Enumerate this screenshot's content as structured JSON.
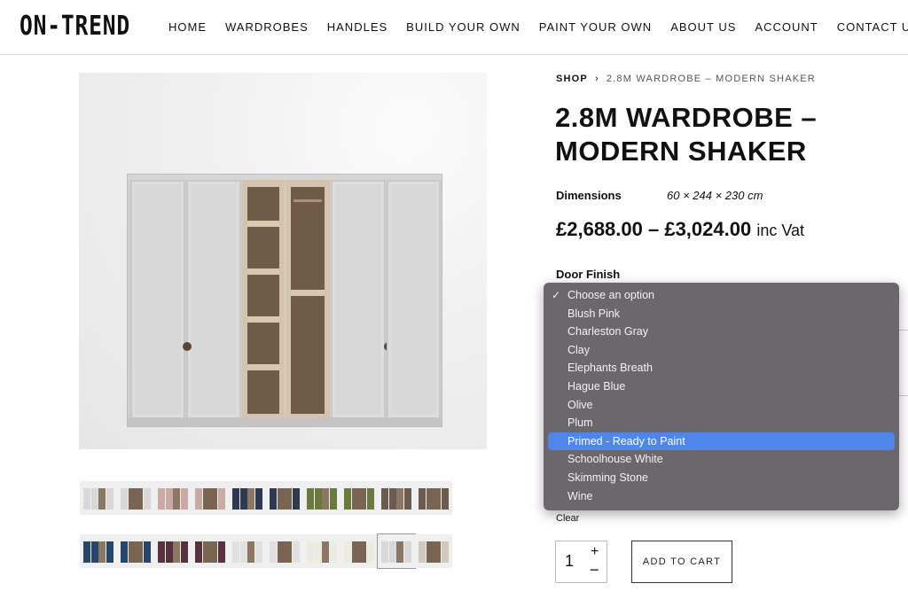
{
  "brand": {
    "logo": "ON-TREND"
  },
  "nav": {
    "items": [
      "HOME",
      "WARDROBES",
      "HANDLES",
      "BUILD YOUR OWN",
      "PAINT YOUR OWN",
      "ABOUT US",
      "ACCOUNT",
      "CONTACT US"
    ]
  },
  "breadcrumb": {
    "shop": "SHOP",
    "separator": "›",
    "current": "2.8M WARDROBE – MODERN SHAKER"
  },
  "product": {
    "title": "2.8M WARDROBE – MODERN SHAKER",
    "dimensions_label": "Dimensions",
    "dimensions_value": "60 × 244 × 230 cm",
    "price_range": "£2,688.00 – £3,024.00",
    "price_suffix": "inc Vat",
    "door_finish_label": "Door Finish"
  },
  "door_finish_dropdown": {
    "selected_check": "✓",
    "options": [
      "Choose an option",
      "Blush Pink",
      "Charleston Gray",
      "Clay",
      "Elephants Breath",
      "Hague Blue",
      "Olive",
      "Plum",
      "Primed - Ready to Paint",
      "Schoolhouse White",
      "Skimming Stone",
      "Wine"
    ],
    "checked_index": 0,
    "highlighted_index": 8,
    "highlight_color": "#4f86e9"
  },
  "clear_label": "Clear",
  "quantity": {
    "value": "1",
    "plus": "+",
    "minus": "−"
  },
  "add_to_cart_label": "ADD TO CART",
  "thumbnails": {
    "row1_colors": [
      "#d9d8d8",
      "#d9d8d8",
      "#c9a9a4",
      "#c9a9a4",
      "#2f3a52",
      "#2f3a52",
      "#6a7a3c",
      "#6a7a3c",
      "#6b5a4e",
      "#6b5a4e"
    ],
    "row2_colors": [
      "#26476b",
      "#26476b",
      "#55323c",
      "#55323c",
      "#e0e0e0",
      "#e0e0e0",
      "#ecebe2",
      "#ecebe2",
      "#d9d8d8",
      "#cfc9c0"
    ],
    "selected_row2_index": 8
  }
}
